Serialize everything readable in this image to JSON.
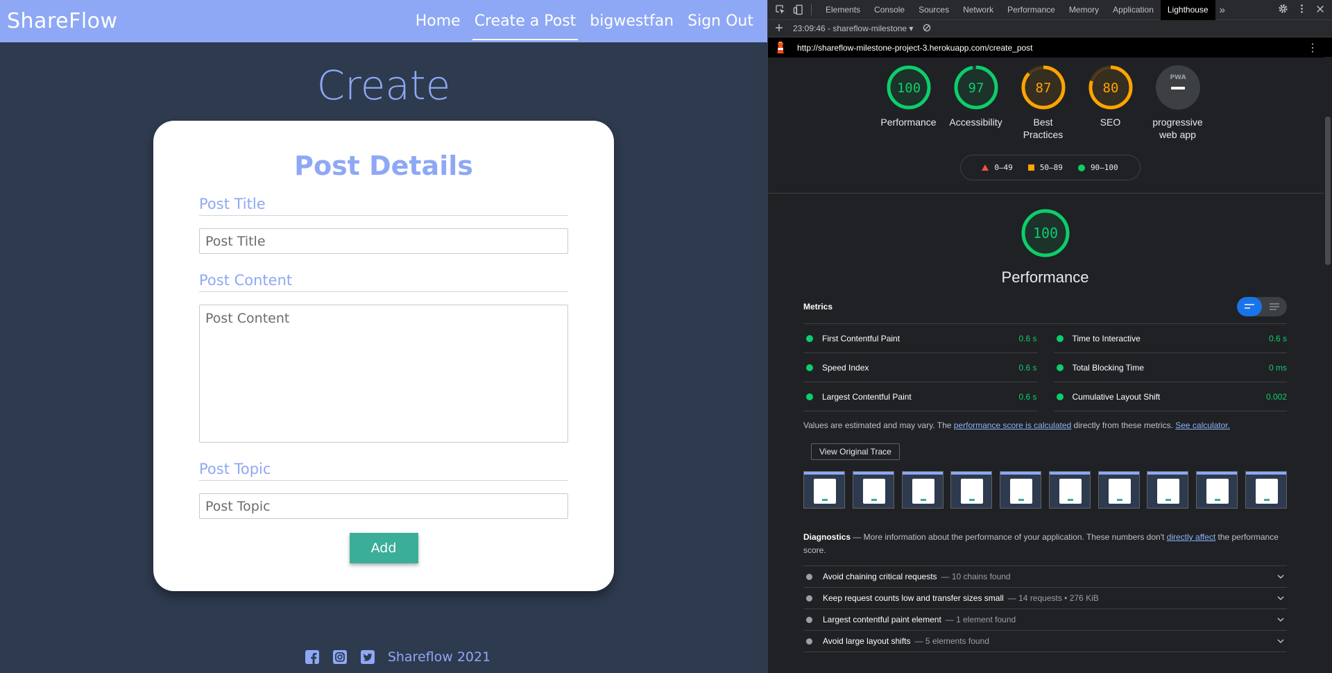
{
  "site": {
    "brand": "ShareFlow",
    "nav": [
      "Home",
      "Create a Post",
      "bigwestfan",
      "Sign Out"
    ],
    "nav_active": "Create a Post",
    "heading": "Create",
    "form": {
      "title": "Post Details",
      "title_label": "Post Title",
      "title_placeholder": "Post Title",
      "content_label": "Post Content",
      "content_placeholder": "Post Content",
      "topic_label": "Post Topic",
      "topic_placeholder": "Post Topic",
      "submit": "Add"
    },
    "footer": {
      "text": "Shareflow 2021",
      "icons": [
        "facebook-icon",
        "instagram-icon",
        "twitter-icon"
      ]
    },
    "colors": {
      "brand": "#8ea8f5",
      "background": "#2e3a4e",
      "button": "#3aae98"
    }
  },
  "devtools": {
    "tabs": [
      "Elements",
      "Console",
      "Sources",
      "Network",
      "Performance",
      "Memory",
      "Application",
      "Lighthouse"
    ],
    "active_tab": "Lighthouse",
    "report_select": "23:09:46 - shareflow-milestone",
    "url": "http://shareflow-milestone-project-3.herokuapp.com/create_post",
    "scores": [
      {
        "label": "Performance",
        "score": 100,
        "color": "#0cce6b"
      },
      {
        "label": "Accessibility",
        "score": 97,
        "color": "#0cce6b"
      },
      {
        "label": "Best Practices",
        "score": 87,
        "color": "#ffa400"
      },
      {
        "label": "SEO",
        "score": 80,
        "color": "#ffa400"
      },
      {
        "label": "progressive web app",
        "score": null,
        "color": "#9aa0a6"
      }
    ],
    "pwa_badge": "PWA",
    "legend": [
      {
        "range": "0–49",
        "color": "#ff4e42"
      },
      {
        "range": "50–89",
        "color": "#ffa400"
      },
      {
        "range": "90–100",
        "color": "#0cce6b"
      }
    ],
    "performance": {
      "score": 100,
      "title": "Performance",
      "metrics_title": "Metrics",
      "metrics": [
        {
          "name": "First Contentful Paint",
          "value": "0.6 s"
        },
        {
          "name": "Time to Interactive",
          "value": "0.6 s"
        },
        {
          "name": "Speed Index",
          "value": "0.6 s"
        },
        {
          "name": "Total Blocking Time",
          "value": "0 ms"
        },
        {
          "name": "Largest Contentful Paint",
          "value": "0.6 s"
        },
        {
          "name": "Cumulative Layout Shift",
          "value": "0.002"
        }
      ],
      "note_pre": "Values are estimated and may vary. The ",
      "note_link1": "performance score is calculated",
      "note_mid": " directly from these metrics. ",
      "note_link2": "See calculator.",
      "trace_button": "View Original Trace"
    },
    "diagnostics": {
      "title": "Diagnostics",
      "desc_pre": " — More information about the performance of your application. These numbers don't ",
      "desc_link": "directly affect",
      "desc_post": " the performance score.",
      "items": [
        {
          "title": "Avoid chaining critical requests",
          "desc": "— 10 chains found"
        },
        {
          "title": "Keep request counts low and transfer sizes small",
          "desc": "— 14 requests • 276 KiB"
        },
        {
          "title": "Largest contentful paint element",
          "desc": "— 1 element found"
        },
        {
          "title": "Avoid large layout shifts",
          "desc": "— 5 elements found"
        }
      ]
    }
  }
}
